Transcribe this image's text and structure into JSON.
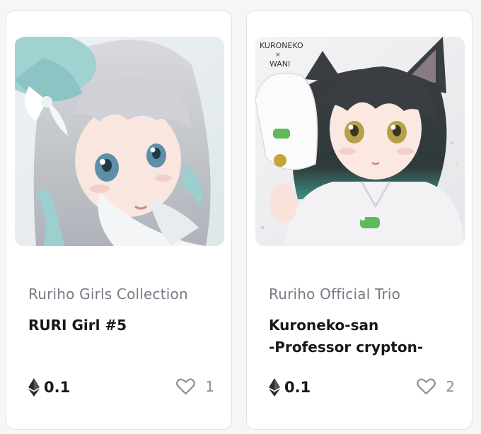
{
  "cards": [
    {
      "collection": "Ruriho Girls Collection",
      "title_lines": [
        "RURI Girl #5"
      ],
      "price": "0.1",
      "likes": "1",
      "currency_icon": "ethereum-icon",
      "like_icon": "heart-outline-icon",
      "image": "anime girl with silver hair and teal hat"
    },
    {
      "collection": "Ruriho Official Trio",
      "title_lines": [
        "Kuroneko-san",
        "-Professor crypton-"
      ],
      "price": "0.1",
      "likes": "2",
      "currency_icon": "ethereum-icon",
      "like_icon": "heart-outline-icon",
      "image": "anime cat girl holding white cap",
      "image_caption": [
        "KURONEKO",
        "×",
        "WANI"
      ]
    }
  ],
  "colors": {
    "page_bg": "#f6f6f8",
    "card_bg": "#ffffff",
    "collection_text": "#757b86",
    "title_text": "#17181c",
    "icon": "#8a8f98"
  }
}
